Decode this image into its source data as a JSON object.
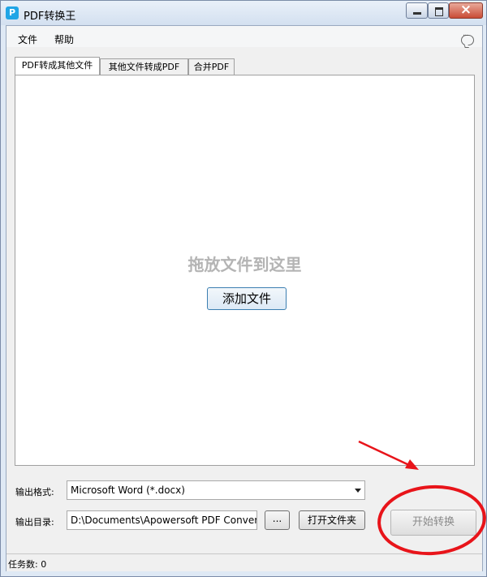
{
  "window": {
    "title": "PDF转换王",
    "app_icon_glyph": "P"
  },
  "menu": {
    "items": [
      "文件",
      "帮助"
    ]
  },
  "tabs": [
    {
      "label": "PDF转成其他文件",
      "active": true
    },
    {
      "label": "其他文件转成PDF",
      "active": false
    },
    {
      "label": "合并PDF",
      "active": false
    }
  ],
  "dropzone": {
    "hint": "拖放文件到这里",
    "add_button": "添加文件"
  },
  "output": {
    "format_label": "输出格式:",
    "format_value": "Microsoft Word (*.docx)",
    "dir_label": "输出目录:",
    "dir_value": "D:\\Documents\\Apowersoft PDF Conver",
    "browse_button": "...",
    "open_folder_button": "打开文件夹"
  },
  "start_button": "开始转换",
  "status": {
    "task_count": "任务数: 0"
  },
  "colors": {
    "annotation_red": "#e8141a",
    "app_icon": "#20a5e6"
  }
}
